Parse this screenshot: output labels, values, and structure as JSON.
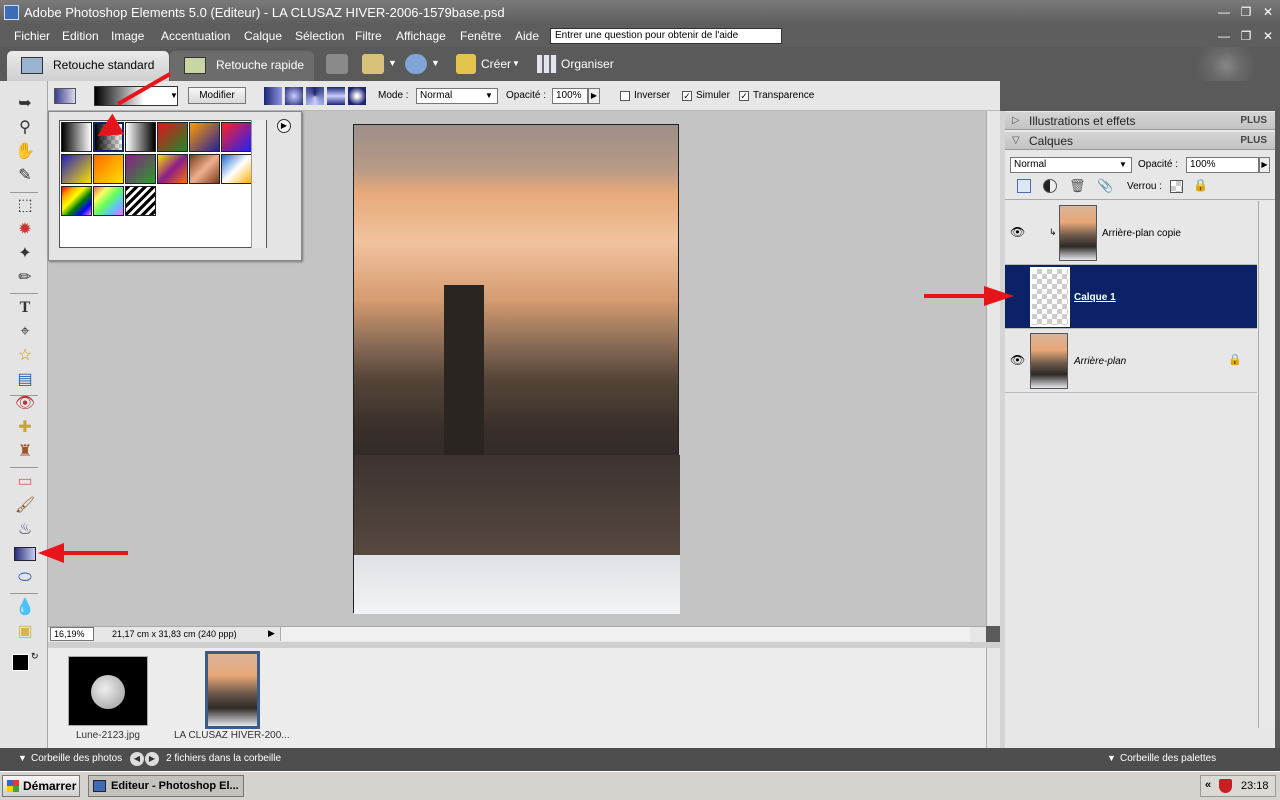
{
  "titlebar": {
    "title": "Adobe Photoshop Elements 5.0 (Editeur) - LA CLUSAZ HIVER-2006-1579base.psd"
  },
  "menu": {
    "items": [
      "Fichier",
      "Edition",
      "Image",
      "Accentuation",
      "Calque",
      "Sélection",
      "Filtre",
      "Affichage",
      "Fenêtre",
      "Aide"
    ],
    "help_placeholder": "Entrer une question pour obtenir de l'aide"
  },
  "tabs": {
    "standard": "Retouche standard",
    "quick": "Retouche rapide"
  },
  "toolbar": {
    "create": "Créer",
    "organize": "Organiser"
  },
  "options": {
    "modify": "Modifier",
    "mode_label": "Mode :",
    "mode_value": "Normal",
    "opacity_label": "Opacité :",
    "opacity_value": "100%",
    "invert": "Inverser",
    "simulate": "Simuler",
    "transparency": "Transparence",
    "invert_checked": false,
    "simulate_checked": true,
    "transparency_checked": true
  },
  "status": {
    "zoom": "16,19%",
    "doc_size": "21,17 cm x 31,83 cm (240 ppp)"
  },
  "photobin": {
    "items": [
      {
        "name": "Lune-2123.jpg"
      },
      {
        "name": "LA CLUSAZ HIVER-200..."
      }
    ]
  },
  "binfooter": {
    "bin": "Corbeille des photos",
    "count": "2 fichiers dans la corbeille",
    "palettes": "Corbeille des palettes"
  },
  "panels": {
    "effects": {
      "title": "Illustrations et effets",
      "plus": "PLUS"
    },
    "layers": {
      "title": "Calques",
      "plus": "PLUS",
      "blend": "Normal",
      "opacity_label": "Opacité :",
      "opacity_value": "100%",
      "lock_label": "Verrou :"
    }
  },
  "layers": [
    {
      "name": "Arrière-plan copie",
      "visible": true
    },
    {
      "name": "Calque 1",
      "selected": true
    },
    {
      "name": "Arrière-plan",
      "visible": true,
      "locked": true
    }
  ],
  "taskbar": {
    "start": "Démarrer",
    "window": "Editeur - Photoshop El...",
    "clock": "23:18"
  },
  "colors": {
    "selection": "#0b2266",
    "accent_arrow": "#e8141c"
  }
}
